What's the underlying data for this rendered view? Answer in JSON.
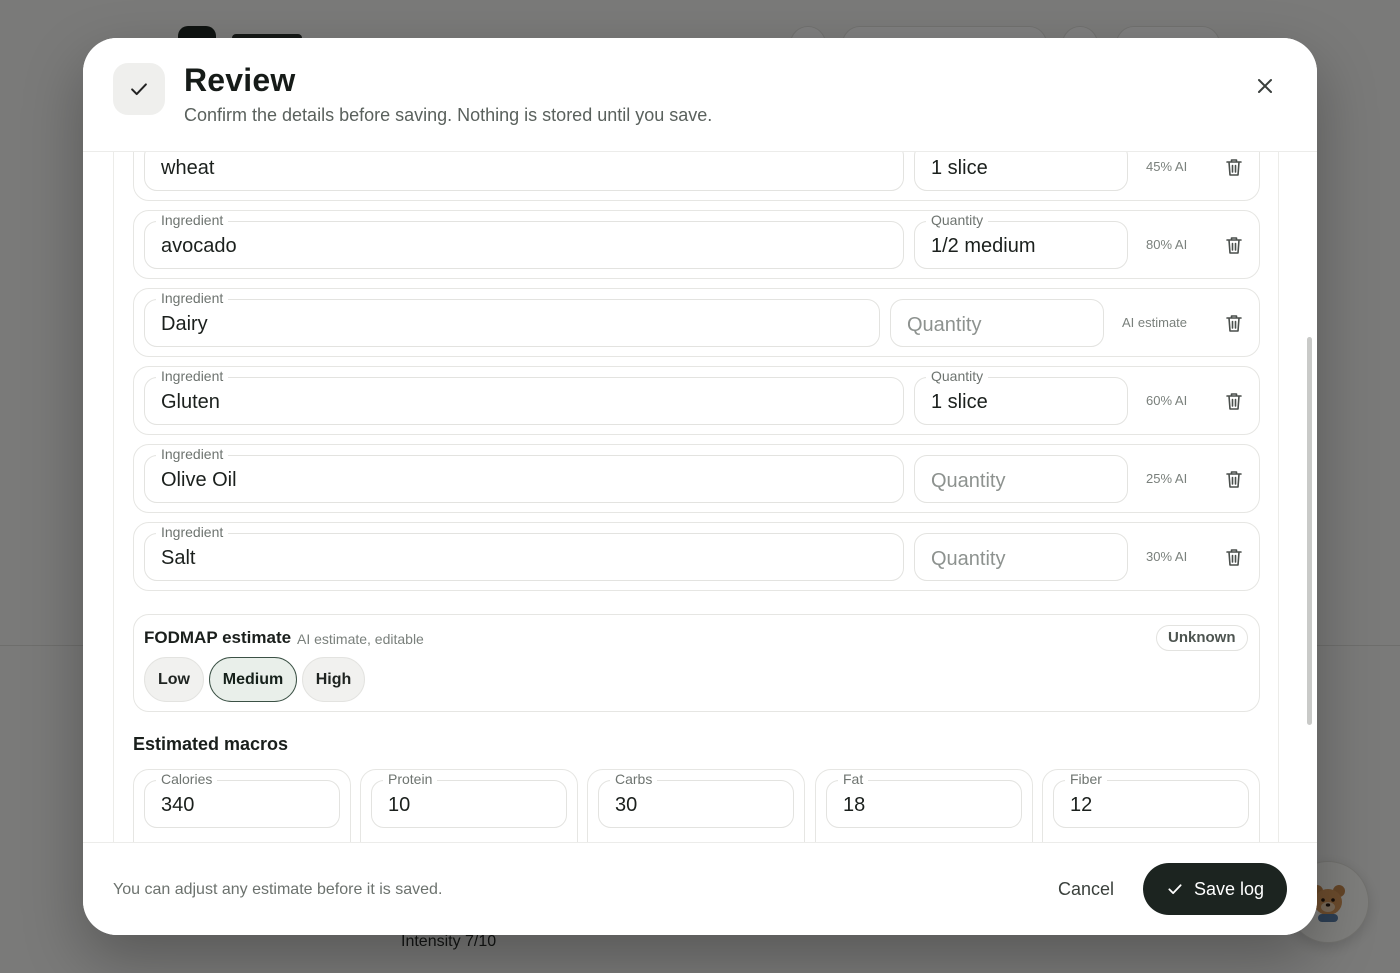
{
  "background": {
    "intensity_text": "Intensity 7/10"
  },
  "modal": {
    "title": "Review",
    "subtitle": "Confirm the details before saving. Nothing is stored until you save.",
    "icons": {
      "header": "check-icon",
      "close": "close-icon"
    }
  },
  "labels": {
    "ingredient": "Ingredient",
    "quantity": "Quantity",
    "quantity_placeholder": "Quantity"
  },
  "ingredients": [
    {
      "name": "wheat",
      "quantity": "1 slice",
      "ai": "45% AI"
    },
    {
      "name": "avocado",
      "quantity": "1/2 medium",
      "ai": "80% AI"
    },
    {
      "name": "Dairy",
      "quantity": "",
      "ai": "AI estimate"
    },
    {
      "name": "Gluten",
      "quantity": "1 slice",
      "ai": "60% AI"
    },
    {
      "name": "Olive Oil",
      "quantity": "",
      "ai": "25% AI"
    },
    {
      "name": "Salt",
      "quantity": "",
      "ai": "30% AI"
    }
  ],
  "fodmap": {
    "title": "FODMAP estimate",
    "subtitle": "AI estimate, editable",
    "badge": "Unknown",
    "options": [
      "Low",
      "Medium",
      "High"
    ],
    "selected": "Medium"
  },
  "macros": {
    "heading": "Estimated macros",
    "items": [
      {
        "label": "Calories",
        "value": "340"
      },
      {
        "label": "Protein",
        "value": "10"
      },
      {
        "label": "Carbs",
        "value": "30"
      },
      {
        "label": "Fat",
        "value": "18"
      },
      {
        "label": "Fiber",
        "value": "12"
      }
    ]
  },
  "footer": {
    "note": "You can adjust any estimate before it is saved.",
    "cancel": "Cancel",
    "save": "Save log"
  }
}
